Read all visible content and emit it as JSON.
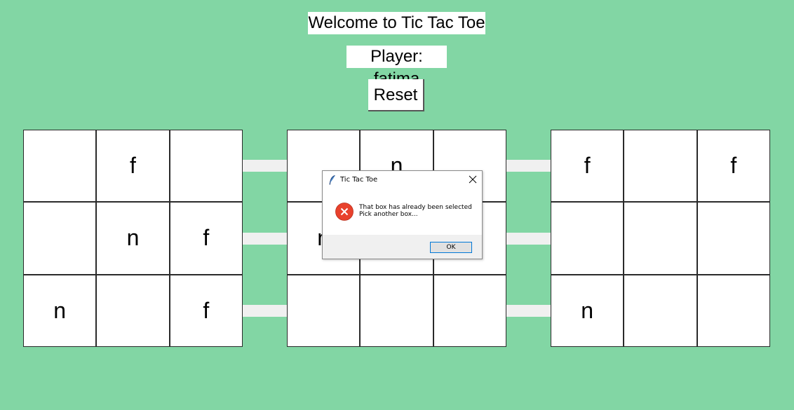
{
  "header": {
    "title": "Welcome to Tic Tac Toe",
    "player": "Player: fatima",
    "reset_label": "Reset"
  },
  "boards": [
    {
      "cells": [
        "",
        "f",
        "",
        "",
        "n",
        "f",
        "n",
        "",
        "f"
      ]
    },
    {
      "cells": [
        "",
        "n",
        "",
        "n",
        "",
        "",
        "",
        "",
        ""
      ]
    },
    {
      "cells": [
        "f",
        "",
        "f",
        "",
        "",
        "",
        "n",
        "",
        ""
      ]
    }
  ],
  "dialog": {
    "title": "Tic Tac Toe",
    "message_line1": "That box has already been selected",
    "message_line2": "Pick another box...",
    "ok_label": "OK",
    "icon": "error-icon"
  },
  "colors": {
    "background": "#82d6a4",
    "error_red": "#e8412c",
    "ok_border": "#0078d7"
  }
}
